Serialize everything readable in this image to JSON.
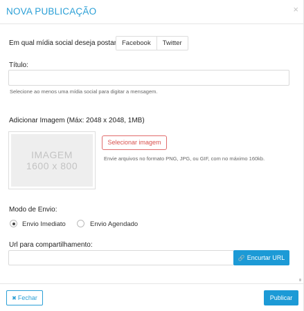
{
  "modal": {
    "title": "NOVA PUBLICAÇÃO",
    "close_glyph": "×"
  },
  "social": {
    "question": "Em qual mídia social deseja postar?",
    "options": [
      "Facebook",
      "Twitter"
    ]
  },
  "titulo": {
    "label": "Título:",
    "value": "",
    "hint": "Selecione ao menos uma mídia social para digitar a mensagem."
  },
  "image": {
    "label": "Adicionar Imagem (Máx: 2048 x 2048, 1MB)",
    "placeholder_line1": "IMAGEM",
    "placeholder_line2": "1600 x 800",
    "select_button": "Selecionar imagem",
    "hint": "Envie arquivos no formato PNG, JPG, ou GIF, com no máximo 160kb."
  },
  "send_mode": {
    "label": "Modo de Envio:",
    "options": [
      {
        "label": "Envio Imediato",
        "checked": true
      },
      {
        "label": "Envio Agendado",
        "checked": false
      }
    ]
  },
  "url": {
    "label": "Url para compartilhamento:",
    "value": "",
    "shorten_button": "Encurtar URL",
    "shorten_icon": "link-icon"
  },
  "footer": {
    "close_button": "Fechar",
    "close_icon": "x-icon",
    "publish_button": "Publicar"
  },
  "colors": {
    "accent": "#2a9fd6",
    "primary_button": "#1c9ad6",
    "danger": "#d9534f"
  }
}
